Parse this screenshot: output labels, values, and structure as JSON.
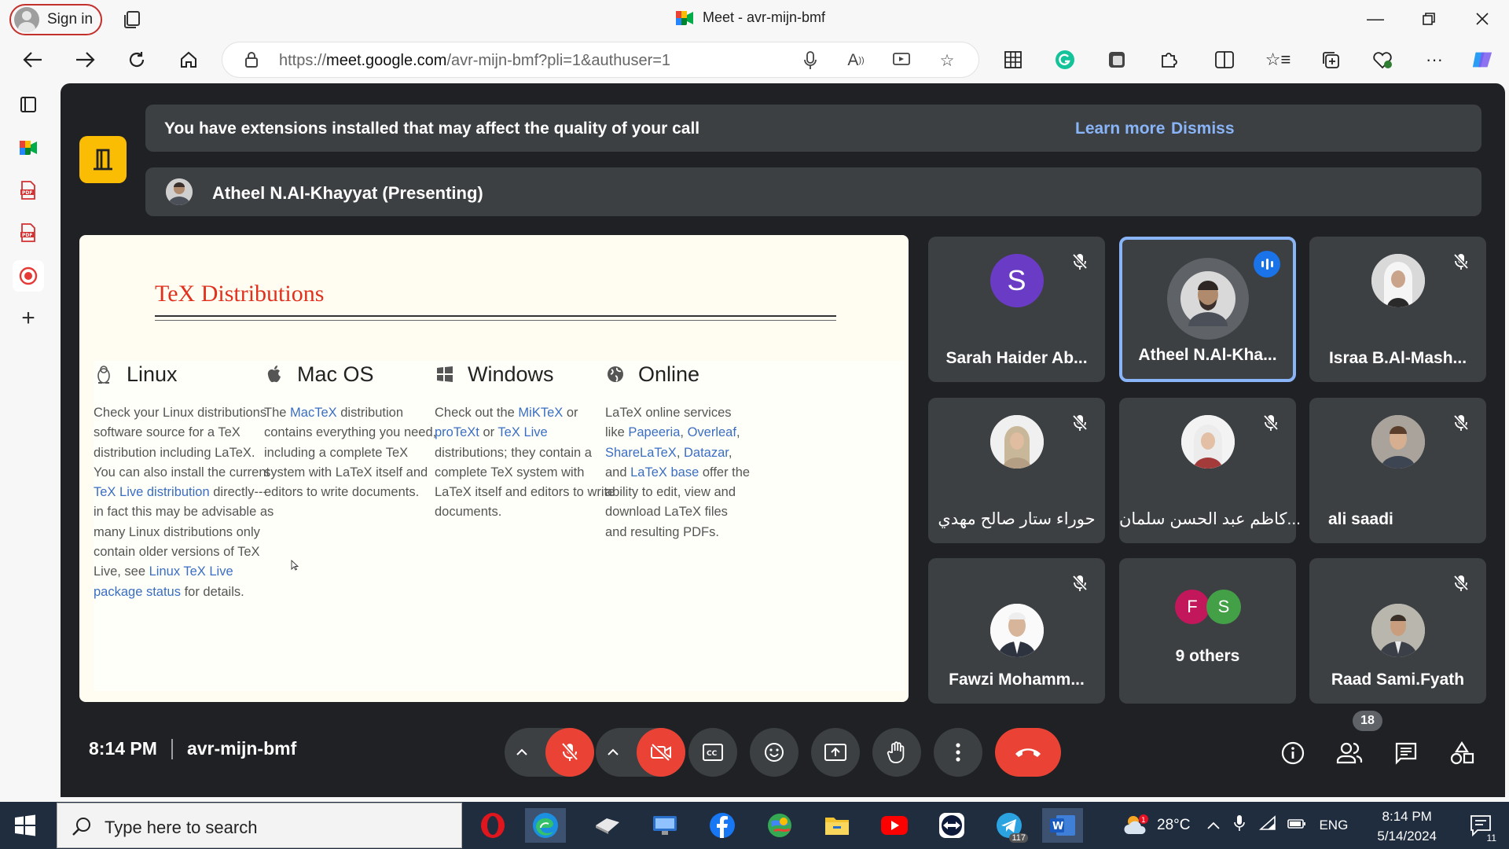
{
  "browser": {
    "sign_in_label": "Sign in",
    "tab_title": "Meet - avr-mijn-bmf",
    "url_prefix": "https://",
    "url_host": "meet.google.com",
    "url_path": "/avr-mijn-bmf?pli=1&authuser=1"
  },
  "banner": {
    "text": "You have extensions installed that may affect the quality of your call",
    "learn_more": "Learn more",
    "dismiss": "Dismiss"
  },
  "presenting": {
    "label": "Atheel N.Al-Khayyat (Presenting)"
  },
  "slide": {
    "title": "TeX Distributions",
    "columns": [
      {
        "icon": "linux-penguin-icon",
        "title": "Linux",
        "parts": [
          {
            "t": "Check your Linux distributions software source for a TeX distribution including LaTeX. You can also install the current "
          },
          {
            "t": "TeX Live distribution",
            "link": true
          },
          {
            "t": " directly---in fact this may be advisable as many Linux distributions only contain older versions of TeX Live, see "
          },
          {
            "t": "Linux TeX Live package status",
            "link": true
          },
          {
            "t": " for details."
          }
        ]
      },
      {
        "icon": "apple-icon",
        "title": "Mac OS",
        "parts": [
          {
            "t": "The "
          },
          {
            "t": "MacTeX",
            "link": true
          },
          {
            "t": " distribution contains everything you need, including a complete TeX system with LaTeX itself and editors to write documents."
          }
        ]
      },
      {
        "icon": "windows-icon",
        "title": "Windows",
        "parts": [
          {
            "t": "Check out the "
          },
          {
            "t": "MiKTeX",
            "link": true
          },
          {
            "t": " or "
          },
          {
            "t": "proTeXt",
            "link": true
          },
          {
            "t": " or "
          },
          {
            "t": "TeX Live",
            "link": true
          },
          {
            "t": " distributions; they contain a complete TeX system with LaTeX itself and editors to write documents."
          }
        ]
      },
      {
        "icon": "globe-icon",
        "title": "Online",
        "parts": [
          {
            "t": "LaTeX online services like "
          },
          {
            "t": "Papeeria",
            "link": true
          },
          {
            "t": ", "
          },
          {
            "t": "Overleaf",
            "link": true
          },
          {
            "t": ", "
          },
          {
            "t": "ShareLaTeX",
            "link": true
          },
          {
            "t": ", "
          },
          {
            "t": "Datazar",
            "link": true
          },
          {
            "t": ", and "
          },
          {
            "t": "LaTeX base",
            "link": true
          },
          {
            "t": " offer the ability to edit, view and download LaTeX files and resulting PDFs."
          }
        ]
      }
    ]
  },
  "participants": [
    {
      "name": "Sarah Haider Ab...",
      "avatar_letter": "S",
      "avatar_color": "#6a3bc4",
      "muted": true
    },
    {
      "name": "Atheel N.Al-Kha...",
      "speaking": true
    },
    {
      "name": "Israa B.Al-Mash...",
      "muted": true
    },
    {
      "name": "حوراء ستار صالح مهدي",
      "muted": true
    },
    {
      "name": "كاظم عبد الحسن سلمان...",
      "muted": true
    },
    {
      "name": "ali saadi",
      "muted": true
    },
    {
      "name": "Fawzi Mohamm...",
      "muted": true
    },
    {
      "name": "9 others",
      "avatars": [
        {
          "letter": "F",
          "color": "#c2185b"
        },
        {
          "letter": "S",
          "color": "#43a047"
        }
      ]
    },
    {
      "name": "Raad Sami.Fyath",
      "muted": true
    }
  ],
  "bottom_bar": {
    "time": "8:14 PM",
    "meeting_code": "avr-mijn-bmf",
    "people_count": "18"
  },
  "taskbar": {
    "search_placeholder": "Type here to search",
    "weather": "28°C",
    "language": "ENG",
    "time": "8:14 PM",
    "date": "5/14/2024",
    "telegram_badge": "117",
    "notification_count": "11"
  },
  "colors": {
    "meet_bg": "#202124",
    "tile_bg": "#3c4043",
    "accent_blue": "#8ab4f8",
    "hangup_red": "#ea4335",
    "exit_yellow": "#fbbc04",
    "slide_title_red": "#e1311e"
  }
}
